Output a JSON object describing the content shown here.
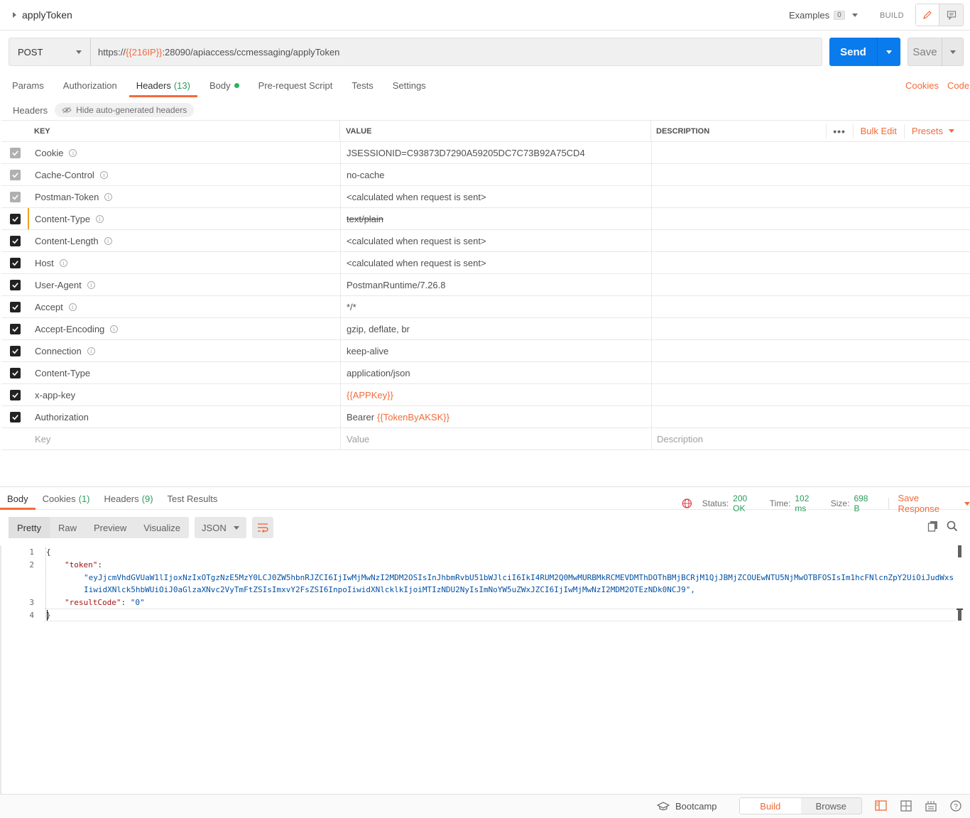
{
  "request": {
    "name": "applyToken",
    "examples_label": "Examples",
    "examples_count": "0",
    "build_label": "BUILD",
    "method": "POST",
    "url_prefix": "https://",
    "url_var": "{{216IP}}",
    "url_suffix": ":28090/apiaccess/ccmessaging/applyToken",
    "send_label": "Send",
    "save_label": "Save"
  },
  "tabs": [
    {
      "label": "Params"
    },
    {
      "label": "Authorization"
    },
    {
      "label": "Headers",
      "count": "(13)"
    },
    {
      "label": "Body"
    },
    {
      "label": "Pre-request Script"
    },
    {
      "label": "Tests"
    },
    {
      "label": "Settings"
    }
  ],
  "right_links": {
    "cookies": "Cookies",
    "code": "Code"
  },
  "headers_section": {
    "title": "Headers",
    "hide_label": "Hide auto-generated headers"
  },
  "table": {
    "col_key": "KEY",
    "col_value": "VALUE",
    "col_desc": "DESCRIPTION",
    "bulk_edit": "Bulk Edit",
    "presets": "Presets",
    "rows": [
      {
        "key": "Cookie",
        "value": "JSESSIONID=C93873D7290A59205DC7C73B92A75CD4"
      },
      {
        "key": "Cache-Control",
        "value": "no-cache"
      },
      {
        "key": "Postman-Token",
        "value": "<calculated when request is sent>"
      },
      {
        "key": "Content-Type",
        "value": "text/plain"
      },
      {
        "key": "Content-Length",
        "value": "<calculated when request is sent>"
      },
      {
        "key": "Host",
        "value": "<calculated when request is sent>"
      },
      {
        "key": "User-Agent",
        "value": "PostmanRuntime/7.26.8"
      },
      {
        "key": "Accept",
        "value": "*/*"
      },
      {
        "key": "Accept-Encoding",
        "value": "gzip, deflate, br"
      },
      {
        "key": "Connection",
        "value": "keep-alive"
      },
      {
        "key": "Content-Type",
        "value": "application/json"
      },
      {
        "key": "x-app-key",
        "value": "{{APPKey}}"
      },
      {
        "key": "Authorization",
        "value_prefix": "Bearer ",
        "value": "{{TokenByAKSK}}"
      }
    ],
    "placeholder_key": "Key",
    "placeholder_value": "Value",
    "placeholder_desc": "Description"
  },
  "response": {
    "tabs": [
      {
        "label": "Body"
      },
      {
        "label": "Cookies",
        "count": "(1)"
      },
      {
        "label": "Headers",
        "count": "(9)"
      },
      {
        "label": "Test Results"
      }
    ],
    "status_label": "Status:",
    "status_value": "200 OK",
    "time_label": "Time:",
    "time_value": "102 ms",
    "size_label": "Size:",
    "size_value": "698 B",
    "save_response": "Save Response",
    "views": [
      "Pretty",
      "Raw",
      "Preview",
      "Visualize"
    ],
    "format": "JSON",
    "code": {
      "l1": "{",
      "token_key": "\"token\"",
      "token_line1": "\"eyJjcmVhdGVUaW1lIjoxNzIxOTgzNzE5MzY0LCJ0ZW5hbnRJZCI6IjIwMjMwNzI2MDM2OSIsInJhbmRvbU51bWJlciI6IkI4RUM2Q0MwMURBMkRCMEVDMThDOThBMjBCRjM1QjJBMjZCOUEwNTU5NjMwOTBFOSIsIm1hcFNlcnZpY2UiOiJudWxs",
      "token_line2": "IiwidXNlck5hbWUiOiJ0aGlzaXNvc2VyTmFtZSIsImxvY2FsZSI6InpoIiwidXNlcklkIjoiMTIzNDU2NyIsImNoYW5uZWxJZCI6IjIwMjMwNzI2MDM2OTEzNDk0NCJ9\",",
      "result_key": "\"resultCode\"",
      "result_value": "\"0\"",
      "l4": "}"
    }
  },
  "bottom": {
    "bootcamp": "Bootcamp",
    "build": "Build",
    "browse": "Browse"
  }
}
